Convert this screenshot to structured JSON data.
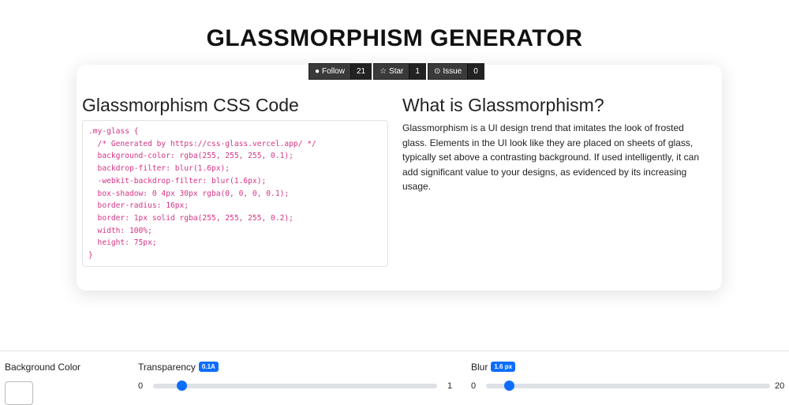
{
  "title": "GLASSMORPHISM GENERATOR",
  "github": {
    "follow": "Follow",
    "follow_count": "21",
    "star": "Star",
    "star_count": "1",
    "issue": "Issue",
    "issue_count": "0"
  },
  "code_heading": "Glassmorphism CSS Code",
  "code": ".my-glass {\n  /* Generated by https://css-glass.vercel.app/ */\n  background-color: rgba(255, 255, 255, 0.1);\n  backdrop-filter: blur(1.6px);\n  -webkit-backdrop-filter: blur(1.6px);\n  box-shadow: 0 4px 30px rgba(0, 0, 0, 0.1);\n  border-radius: 16px;\n  border: 1px solid rgba(255, 255, 255, 0.2);\n  width: 100%;\n  height: 75px;\n}",
  "info_heading": "What is Glassmorphism?",
  "info_text": "Glassmorphism is a UI design trend that imitates the look of frosted glass. Elements in the UI look like they are placed on sheets of glass, typically set above a contrasting background. If used intelligently, it can add significant value to your designs, as evidenced by its increasing usage.",
  "controls": {
    "bg_label": "Background Color",
    "bg_color": "#ffffff",
    "transparency_label": "Transparency",
    "transparency_badge": "0.1A",
    "transparency_min": "0",
    "transparency_max": "1",
    "transparency_value": 0.1,
    "blur_label": "Blur",
    "blur_badge": "1.6 px",
    "blur_min": "0",
    "blur_max": "20",
    "blur_value": 1.6
  }
}
